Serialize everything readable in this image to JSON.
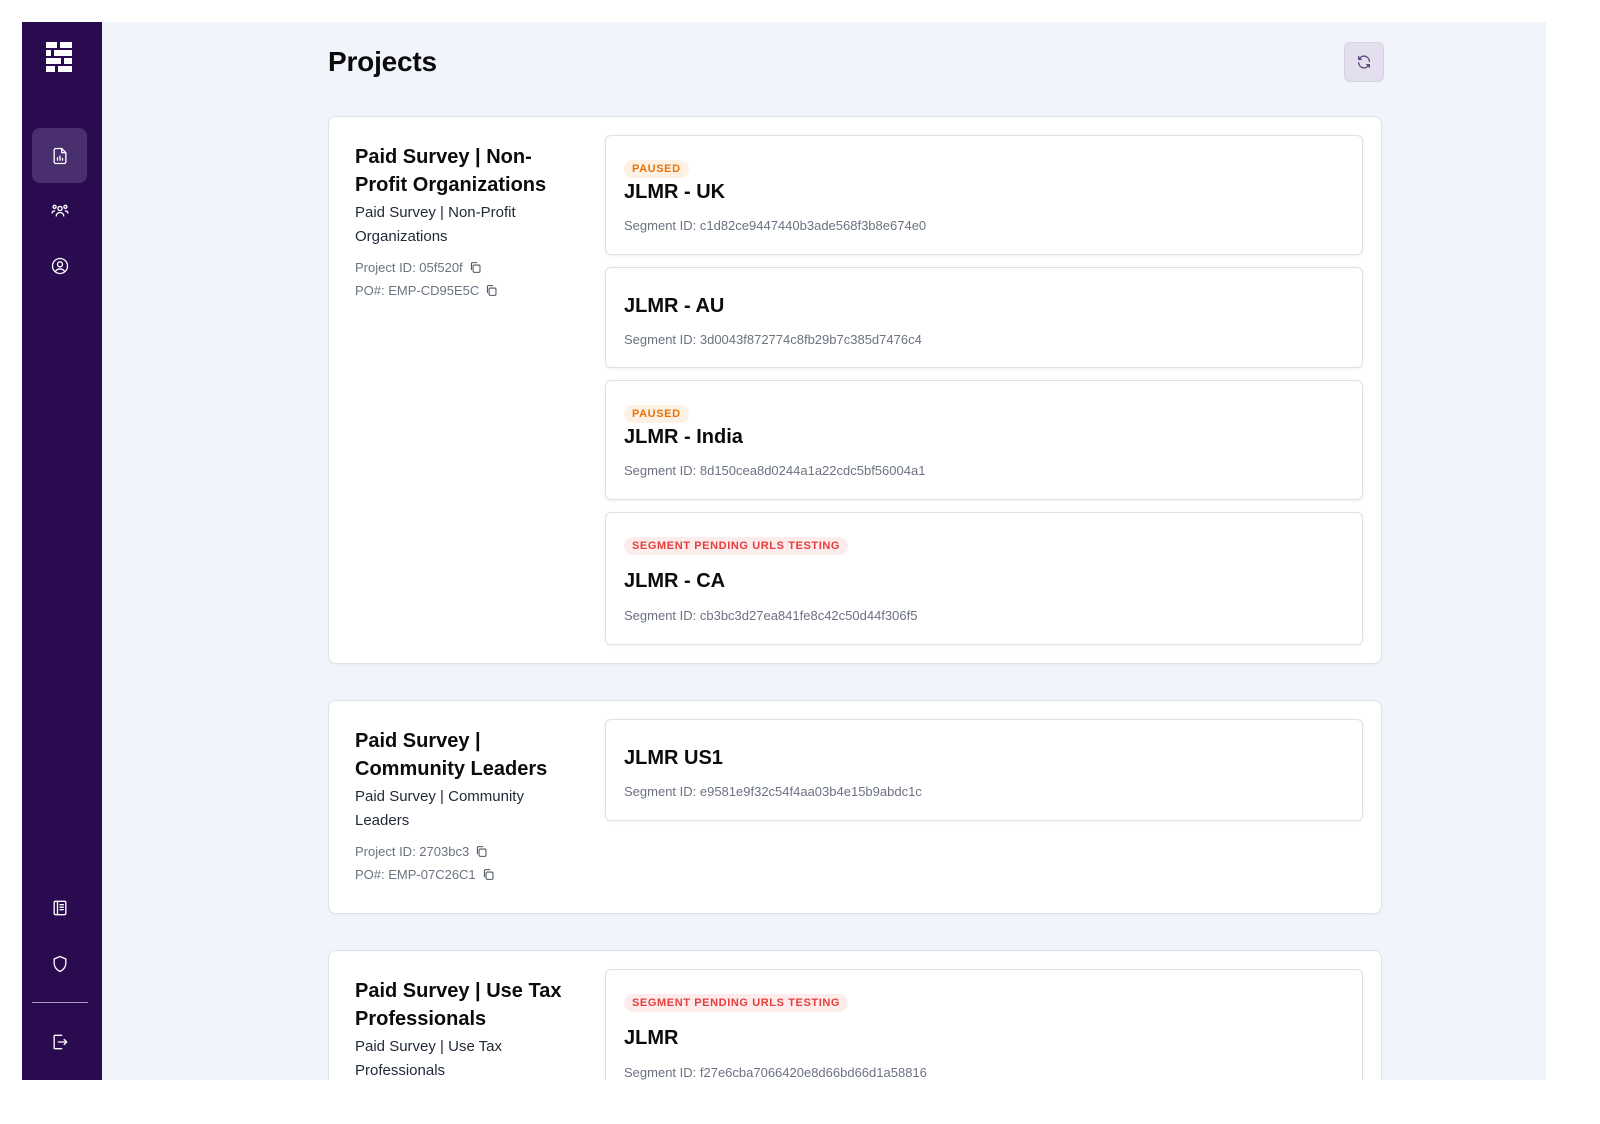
{
  "page": {
    "title": "Projects"
  },
  "colors": {
    "sidebar": "#2a0b4f",
    "paused": "#e8730c",
    "pending": "#e53e3e"
  },
  "sidebar": {
    "logo": "grid-logo-icon",
    "top_items": [
      {
        "name": "reports",
        "icon": "report-document-icon",
        "active": true
      },
      {
        "name": "users",
        "icon": "users-group-icon",
        "active": false
      },
      {
        "name": "account",
        "icon": "user-circle-icon",
        "active": false
      }
    ],
    "bottom_items": [
      {
        "name": "docs",
        "icon": "book-icon"
      },
      {
        "name": "security",
        "icon": "shield-icon"
      },
      {
        "name": "logout",
        "icon": "logout-icon"
      }
    ]
  },
  "projects": [
    {
      "name": "Paid Survey | Non-Profit Organizations",
      "description": "Paid Survey | Non-Profit Organizations",
      "project_id": "Project ID: 05f520f",
      "po": "PO#: EMP-CD95E5C",
      "segments": [
        {
          "badge": "PAUSED",
          "name": "JLMR - UK",
          "segment_id": "Segment ID: c1d82ce9447440b3ade568f3b8e674e0"
        },
        {
          "badge": "",
          "name": "JLMR - AU",
          "segment_id": "Segment ID: 3d0043f872774c8fb29b7c385d7476c4"
        },
        {
          "badge": "PAUSED",
          "name": "JLMR - India",
          "segment_id": "Segment ID: 8d150cea8d0244a1a22cdc5bf56004a1"
        },
        {
          "badge": "SEGMENT PENDING URLS TESTING",
          "name": "JLMR - CA",
          "segment_id": "Segment ID: cb3bc3d27ea841fe8c42c50d44f306f5"
        }
      ]
    },
    {
      "name": "Paid Survey | Community Leaders",
      "description": "Paid Survey | Community Leaders",
      "project_id": "Project ID: 2703bc3",
      "po": "PO#: EMP-07C26C1",
      "segments": [
        {
          "badge": "",
          "name": "JLMR US1",
          "segment_id": "Segment ID: e9581e9f32c54f4aa03b4e15b9abdc1c"
        }
      ]
    },
    {
      "name": "Paid Survey | Use Tax Professionals",
      "description": "Paid Survey | Use Tax Professionals",
      "project_id": "",
      "po": "",
      "segments": [
        {
          "badge": "SEGMENT PENDING URLS TESTING",
          "name": "JLMR",
          "segment_id": "Segment ID: f27e6cba7066420e8d66bd66d1a58816"
        }
      ]
    }
  ]
}
